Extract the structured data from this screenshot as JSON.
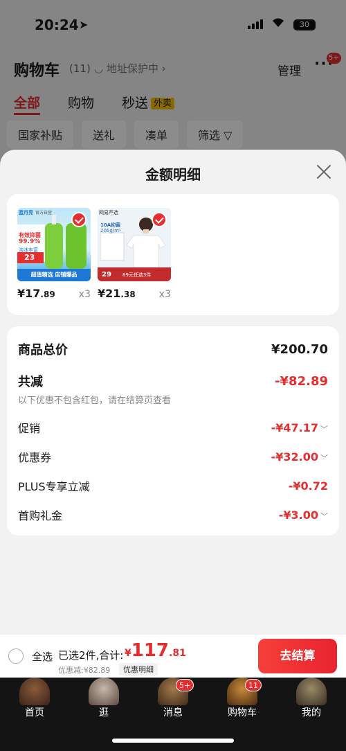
{
  "status_bar": {
    "time": "20:24",
    "battery": "30"
  },
  "cart": {
    "title": "购物车",
    "count": "(11)",
    "address_protect": "地址保护中 ›",
    "manage": "管理",
    "more_badge": "5+",
    "tabs": [
      {
        "label": "全部",
        "active": true
      },
      {
        "label": "购物"
      },
      {
        "label": "秒送",
        "badge": "外卖"
      }
    ],
    "filters": [
      "国家补贴",
      "送礼",
      "凑单",
      "筛选 ▽"
    ]
  },
  "sheet": {
    "title": "金额明细",
    "products": [
      {
        "name": "蓝月亮洗手液",
        "price_int": "¥17",
        "price_dec": ".89",
        "qty": "x3",
        "img_text": {
          "brand": "蓝月亮",
          "flag": "官方自营",
          "line1": "有效抑菌",
          "line2": "99.9%",
          "line3": "泡沫丰富",
          "promo_price": "23",
          "banner": "超值精选 店铺爆品"
        }
      },
      {
        "name": "网易严选T恤",
        "price_int": "¥21",
        "price_dec": ".38",
        "qty": "x3",
        "img_text": {
          "brand": "网易严选",
          "line1": "10A抑菌",
          "line2": "205g/m²",
          "promo_price": "29",
          "banner": "89元任选3件"
        }
      }
    ],
    "total_label": "商品总价",
    "total_value": "¥200.70",
    "discount_label": "共减",
    "discount_value": "-¥82.89",
    "discount_note": "以下优惠不包含红包，请在结算页查看",
    "items": [
      {
        "label": "促销",
        "value": "-¥47.17",
        "has_chevron": true
      },
      {
        "label": "优惠券",
        "value": "-¥32.00",
        "has_chevron": true
      },
      {
        "label": "PLUS专享立减",
        "value": "-¥0.72",
        "has_chevron": false
      },
      {
        "label": "首购礼金",
        "value": "-¥3.00",
        "has_chevron": true
      }
    ]
  },
  "checkout": {
    "select_all": "全选",
    "selected_text": "已选2件,合计:",
    "total_yen": "¥",
    "total_int": "117",
    "total_dec": ".81",
    "saved_text": "优惠减:¥82.89",
    "detail_toggle": "优惠明细",
    "button": "去结算"
  },
  "tabbar": [
    {
      "label": "首页",
      "icon": "avatar-warrior-icon"
    },
    {
      "label": "逛",
      "icon": "avatar-elder-icon"
    },
    {
      "label": "消息",
      "icon": "avatar-monkey-icon",
      "badge": "5+"
    },
    {
      "label": "购物车",
      "icon": "avatar-monk-icon",
      "badge": "11"
    },
    {
      "label": "我的",
      "icon": "avatar-beast-icon"
    }
  ],
  "colors": {
    "accent": "#e62e2e",
    "background": "#f2f2f2",
    "tabbar": "#141414"
  }
}
